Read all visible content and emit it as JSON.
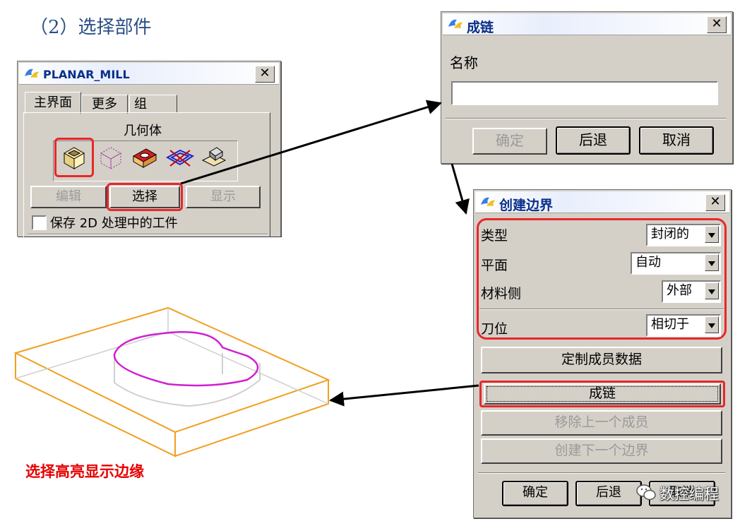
{
  "heading": "（2）选择部件",
  "planar": {
    "title": "PLANAR_MILL",
    "tabs": [
      "主界面",
      "更多",
      "组"
    ],
    "section": "几何体",
    "icons": [
      "part-geometry-icon",
      "blank-geometry-icon",
      "check-geometry-icon",
      "trim-geometry-icon",
      "floor-geometry-icon"
    ],
    "buttons": {
      "edit": "编辑",
      "select": "选择",
      "display": "显示"
    },
    "checkbox_label": "保存 2D 处理中的工件"
  },
  "chain": {
    "title": "成链",
    "name_label": "名称",
    "name_value": "",
    "ok": "确定",
    "back": "后退",
    "cancel": "取消"
  },
  "boundary": {
    "title": "创建边界",
    "rows": [
      {
        "label": "类型",
        "value": "封闭的"
      },
      {
        "label": "平面",
        "value": "自动"
      },
      {
        "label": "材料侧",
        "value": "外部"
      },
      {
        "label": "刀位",
        "value": "相切于"
      }
    ],
    "custom_data": "定制成员数据",
    "chain_btn": "成链",
    "remove_last": "移除上一个成员",
    "create_next": "创建下一个边界",
    "ok": "确定",
    "back": "后退",
    "cancel": "取消"
  },
  "caption": "选择高亮显示边缘",
  "watermark": "数控编程",
  "colors": {
    "highlight_red": "#e8272b",
    "model_orange": "#f0a020",
    "edge_magenta": "#d020d0",
    "caption_red": "#e60000"
  }
}
